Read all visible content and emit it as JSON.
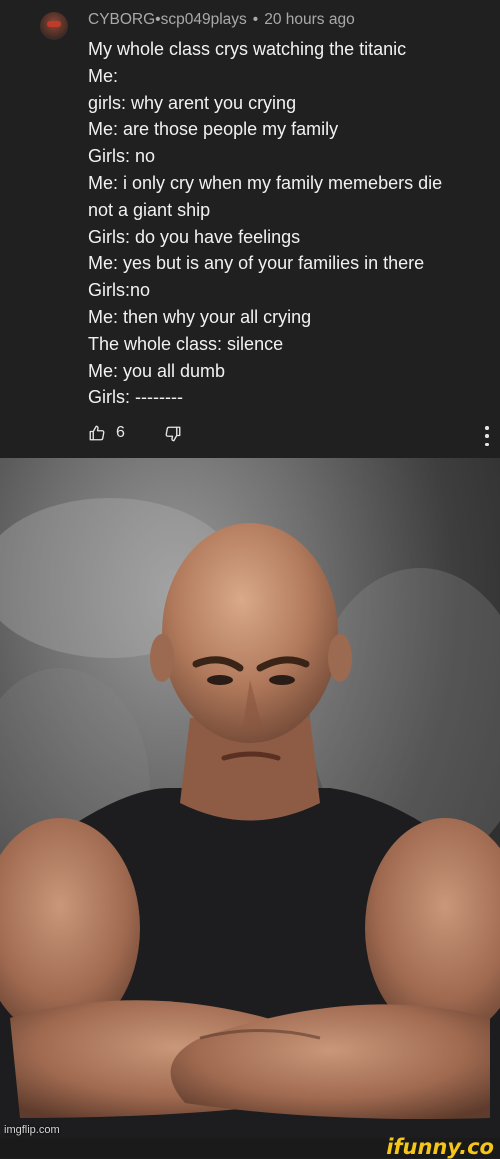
{
  "comment": {
    "author": "CYBORG•scp049plays",
    "separator": "•",
    "time": "20 hours ago",
    "lines": [
      "My whole class crys watching the titanic",
      "Me:",
      "girls: why arent you crying",
      "Me: are those people my family",
      "Girls: no",
      "Me: i only cry when my family memebers die",
      "not a giant ship",
      "Girls: do you have feelings",
      "Me: yes but is any of your families in there",
      "Girls:no",
      "Me: then why your all crying",
      "The whole class: silence",
      "Me: you all dumb",
      "Girls: --------"
    ],
    "like_count": "6",
    "icons": {
      "like": "thumbs-up-icon",
      "dislike": "thumbs-down-icon",
      "more": "more-vertical-icon",
      "avatar": "avatar"
    }
  },
  "image": {
    "description_icon": "photo",
    "watermark": "imgflip.com"
  },
  "footer": {
    "logo": "ifunny.co",
    "logo_color": "#f5c518"
  }
}
